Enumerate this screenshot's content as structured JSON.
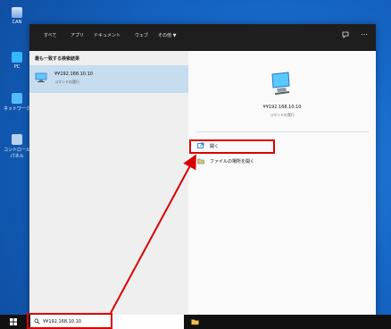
{
  "desktop": {
    "icons": [
      {
        "label": "CAN",
        "icon": "recycle-bin-icon"
      },
      {
        "label": "PC",
        "icon": "computer-icon"
      },
      {
        "label": "ネットワーク",
        "icon": "network-icon"
      },
      {
        "label": "コントロールパネル",
        "icon": "control-panel-icon"
      }
    ]
  },
  "search_panel": {
    "tabs": [
      "すべて",
      "アプリ",
      "ドキュメント",
      "ウェブ",
      "その他"
    ],
    "tab_more_indicator": "▼",
    "best_match_header": "最も一致する検索結果",
    "best_match": {
      "title": "¥¥192.168.10.10",
      "subtitle": "コマンドの実行"
    },
    "detail": {
      "title": "¥¥192.168.10.10",
      "subtitle": "コマンドの実行"
    },
    "actions": [
      {
        "label": "開く",
        "icon": "open-icon"
      },
      {
        "label": "ファイルの場所を開く",
        "icon": "folder-location-icon"
      }
    ],
    "header_right_icons": [
      "feedback-icon",
      "more-options-icon"
    ]
  },
  "taskbar": {
    "search_value": "¥¥192.168.10.10",
    "search_placeholder": "",
    "start_icon": "windows-start-icon",
    "search_icon": "search-icon",
    "app_icon": "file-explorer-icon"
  },
  "colors": {
    "desktop": "#1668c9",
    "accent": "#0078d7",
    "highlight": "#d90000",
    "best_match_bg": "#c6dcef"
  }
}
